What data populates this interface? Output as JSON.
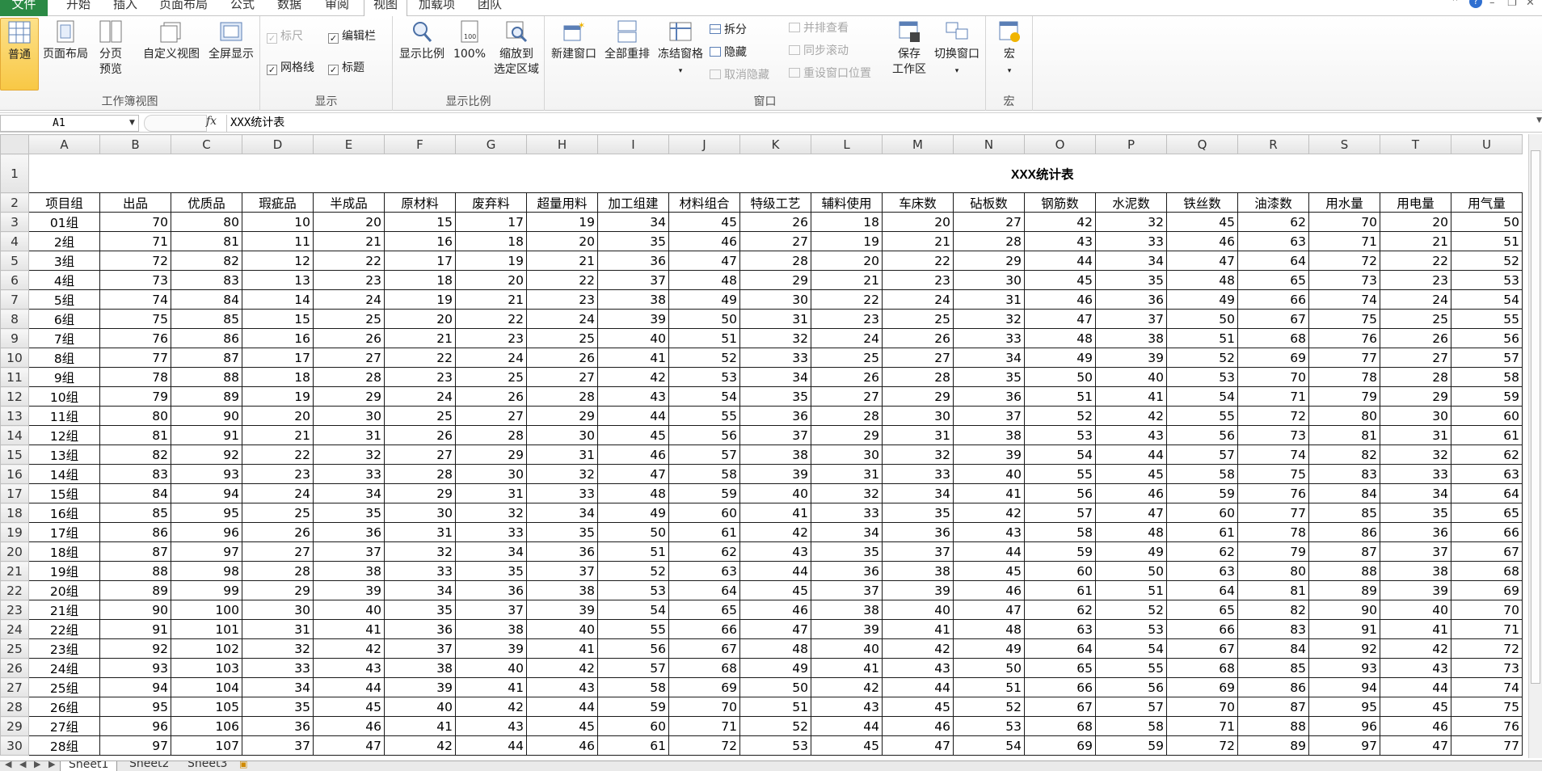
{
  "ribbon_tabs": [
    "文件",
    "开始",
    "插入",
    "页面布局",
    "公式",
    "数据",
    "审阅",
    "视图",
    "加载项",
    "团队"
  ],
  "ribbon": {
    "workbook_views": {
      "label": "工作簿视图",
      "normal": "普通",
      "page_layout": "页面布局",
      "page_break_1": "分页",
      "page_break_2": "预览",
      "custom_view": "自定义视图",
      "full_screen": "全屏显示"
    },
    "show": {
      "label": "显示",
      "ruler": "标尺",
      "formula_bar": "编辑栏",
      "gridlines": "网格线",
      "headings": "标题",
      "ruler_checked": "✓",
      "formula_bar_checked": "✓",
      "gridlines_checked": "✓",
      "headings_checked": "✓"
    },
    "zoom": {
      "label": "显示比例",
      "zoom": "显示比例",
      "hundred": "100%",
      "zoom_sel_1": "缩放到",
      "zoom_sel_2": "选定区域"
    },
    "window": {
      "label": "窗口",
      "new_window": "新建窗口",
      "arrange_all": "全部重排",
      "freeze_panes": "冻结窗格",
      "split": "拆分",
      "hide": "隐藏",
      "unhide": "取消隐藏",
      "side_by_side": "并排查看",
      "sync_scroll": "同步滚动",
      "reset_position": "重设窗口位置",
      "save_ws_1": "保存",
      "save_ws_2": "工作区",
      "switch_windows": "切换窗口"
    },
    "macros": {
      "label": "宏",
      "macros": "宏"
    }
  },
  "formula_bar": {
    "name_box": "A1",
    "fx": "fx",
    "content": "XXX统计表"
  },
  "sheet": {
    "columns": [
      "A",
      "B",
      "C",
      "D",
      "E",
      "F",
      "G",
      "H",
      "I",
      "J",
      "K",
      "L",
      "M",
      "N",
      "O",
      "P",
      "Q",
      "R",
      "S",
      "T",
      "U"
    ],
    "title": "XXX统计表",
    "headers": [
      "项目组",
      "出品",
      "优质品",
      "瑕疵品",
      "半成品",
      "原材料",
      "废弃料",
      "超量用料",
      "加工组建",
      "材料组合",
      "特级工艺",
      "辅料使用",
      "车床数",
      "砧板数",
      "钢筋数",
      "水泥数",
      "铁丝数",
      "油漆数",
      "用水量",
      "用电量",
      "用气量"
    ],
    "groups": [
      "01组",
      "2组",
      "3组",
      "4组",
      "5组",
      "6组",
      "7组",
      "8组",
      "9组",
      "10组",
      "11组",
      "12组",
      "13组",
      "14组",
      "15组",
      "16组",
      "17组",
      "18组",
      "19组",
      "20组",
      "21组",
      "22组",
      "23组",
      "24组",
      "25组",
      "26组",
      "27组",
      "28组"
    ],
    "col_start_values": [
      70,
      80,
      10,
      20,
      15,
      17,
      19,
      34,
      45,
      26,
      18,
      20,
      27,
      42,
      32,
      45,
      62,
      70,
      20,
      50
    ],
    "first_data_row": 3
  },
  "sheet_tabs": [
    "Sheet1",
    "Sheet2",
    "Sheet3"
  ],
  "colors": {
    "file_tab": "#2b8a45",
    "selected_button": "#f8c845"
  }
}
